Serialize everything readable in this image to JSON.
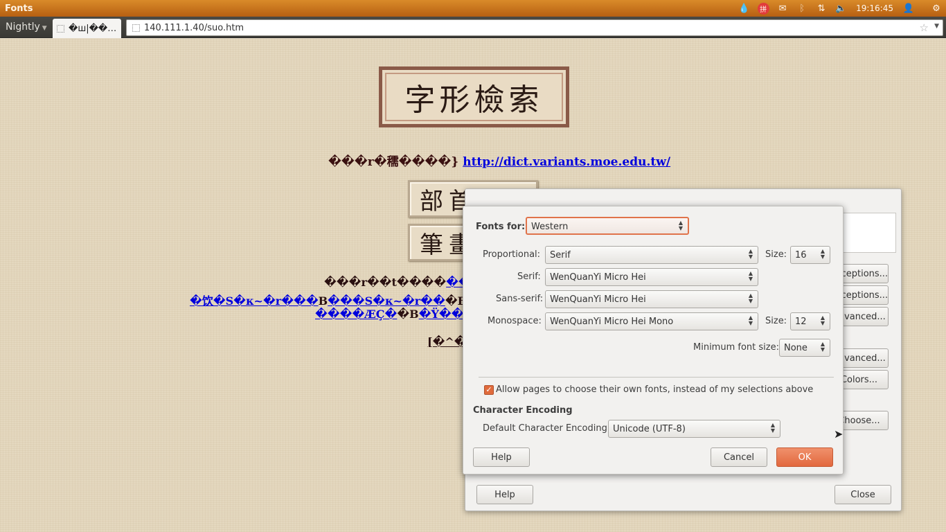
{
  "topbar": {
    "title": "Fonts",
    "clock": "19:16:45",
    "tray_icons": [
      "droplet-icon",
      "input-method-icon",
      "mail-icon",
      "bluetooth-icon",
      "network-icon",
      "volume-icon"
    ],
    "input_method": "拼"
  },
  "browser": {
    "app_menu": "Nightly",
    "tab_title": "�ш|��…",
    "url": "140.111.1.40/suo.htm"
  },
  "page": {
    "banner": "字形檢索",
    "intro_text": "���r�穤����}",
    "intro_link": "http://dict.variants.moe.edu.tw/",
    "buttons": [
      "部首索引",
      "筆畫索引"
    ],
    "garbled_line1_text": "���r��t����",
    "garbled_line1_link": "��",
    "garbled_line2_link1": "�饮�S�к~�r���",
    "garbled_line2_text1": "B",
    "garbled_line2_link2": "���S�к~�r��",
    "garbled_line2_text2": "�B",
    "garbled_line3_link1": "����ÆÇ�",
    "garbled_line3_text": "�B",
    "garbled_line3_link2": "�Ÿ��",
    "garbled_line4": "[�^�"
  },
  "prefs_dialog": {
    "buttons": [
      "Exceptions...",
      "Exceptions...",
      "Advanced...",
      "Advanced...",
      "Colors...",
      "Choose..."
    ],
    "help": "Help",
    "close": "Close"
  },
  "fonts_dialog": {
    "fonts_for_label": "Fonts for:",
    "fonts_for_value": "Western",
    "proportional_label": "Proportional:",
    "proportional_value": "Serif",
    "size_label": "Size:",
    "proportional_size": "16",
    "serif_label": "Serif:",
    "serif_value": "WenQuanYi Micro Hei",
    "sans_label": "Sans-serif:",
    "sans_value": "WenQuanYi Micro Hei",
    "mono_label": "Monospace:",
    "mono_value": "WenQuanYi Micro Hei Mono",
    "mono_size": "12",
    "min_size_label": "Minimum font size:",
    "min_size_value": "None",
    "allow_pages_label": "Allow pages to choose their own fonts, instead of my selections above",
    "allow_pages_checked": true,
    "encoding_heading": "Character Encoding",
    "encoding_label": "Default Character Encoding:",
    "encoding_value": "Unicode (UTF-8)",
    "help": "Help",
    "cancel": "Cancel",
    "ok": "OK"
  },
  "colors": {
    "panel_orange": "#c97020",
    "accent_orange": "#e2683e",
    "link_blue": "#0000dd"
  }
}
